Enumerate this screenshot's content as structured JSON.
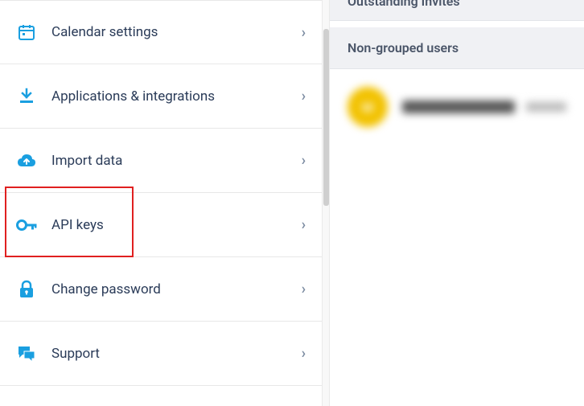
{
  "menu": {
    "items": [
      {
        "icon": "calendar-icon",
        "label": "Calendar settings"
      },
      {
        "icon": "download-icon",
        "label": "Applications & integrations"
      },
      {
        "icon": "cloud-upload-icon",
        "label": "Import data"
      },
      {
        "icon": "key-icon",
        "label": "API keys"
      },
      {
        "icon": "lock-icon",
        "label": "Change password"
      },
      {
        "icon": "chat-icon",
        "label": "Support"
      }
    ],
    "chevron": "›",
    "highlight_index": 3
  },
  "right": {
    "outstanding_invites_header": "Outstanding Invites",
    "non_grouped_header": "Non-grouped users",
    "user_avatar_initials": "M"
  }
}
